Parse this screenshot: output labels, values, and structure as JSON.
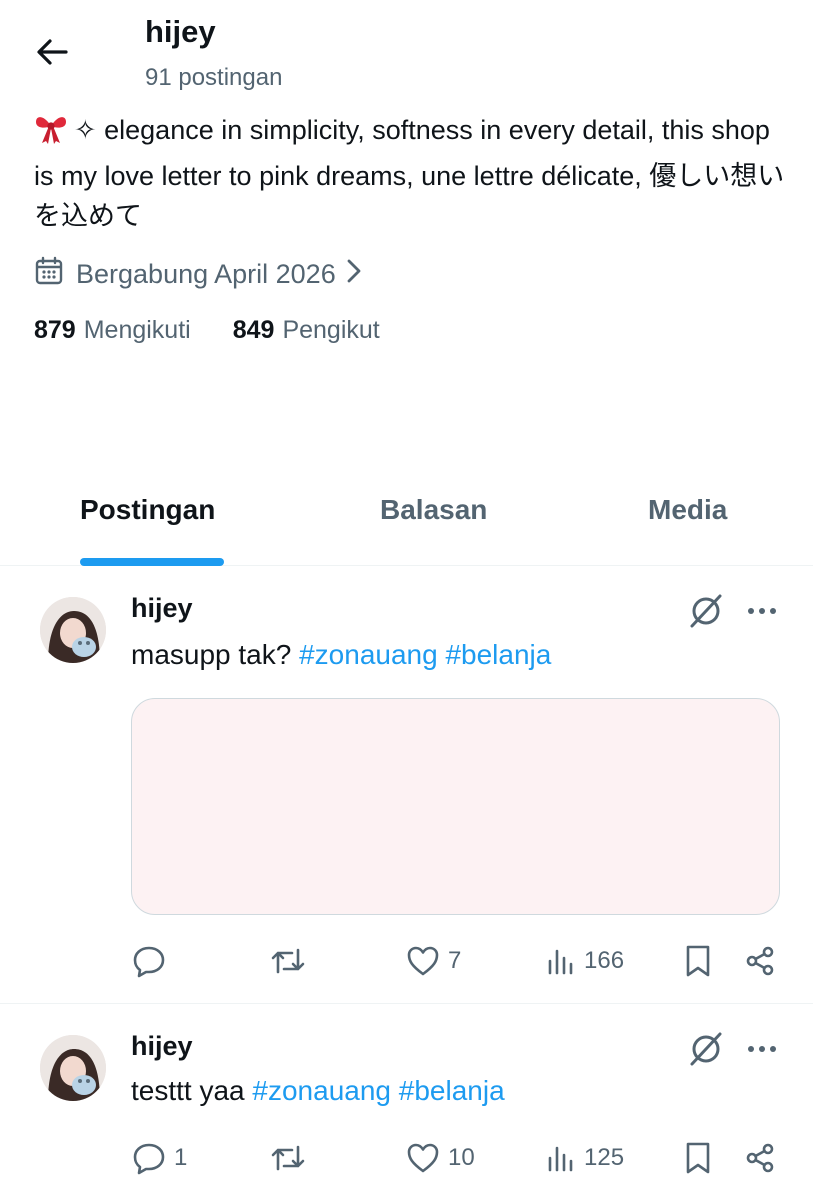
{
  "header": {
    "back_icon": "arrow-left-icon",
    "name": "hijey",
    "post_count": "91 postingan"
  },
  "bio": {
    "emoji_icon": "ribbon-icon",
    "text": "✧ elegance in simplicity, softness in every detail, this shop is my love letter to pink dreams, une lettre délicate, 優しい想いを込めて"
  },
  "joined": {
    "icon": "calendar-icon",
    "text": "Bergabung April 2026"
  },
  "stats": {
    "following_count": "879",
    "following_label": "Mengikuti",
    "followers_count": "849",
    "followers_label": "Pengikut"
  },
  "tabs": [
    {
      "label": "Postingan",
      "active": true
    },
    {
      "label": "Balasan",
      "active": false
    },
    {
      "label": "Media",
      "active": false
    }
  ],
  "colors": {
    "accent": "#1d9bf0",
    "text": "#0f1419",
    "muted": "#536471",
    "media_bg": "#fdf2f3"
  },
  "posts": [
    {
      "author": "hijey",
      "text_plain": "masupp tak? ",
      "hashtags": [
        "#zonauang",
        "#belanja"
      ],
      "has_media": true,
      "replies": "",
      "reposts": "",
      "likes": "7",
      "views": "166"
    },
    {
      "author": "hijey",
      "text_plain": "testtt yaa ",
      "hashtags": [
        "#zonauang",
        "#belanja"
      ],
      "has_media": false,
      "replies": "1",
      "reposts": "",
      "likes": "10",
      "views": "125"
    }
  ]
}
